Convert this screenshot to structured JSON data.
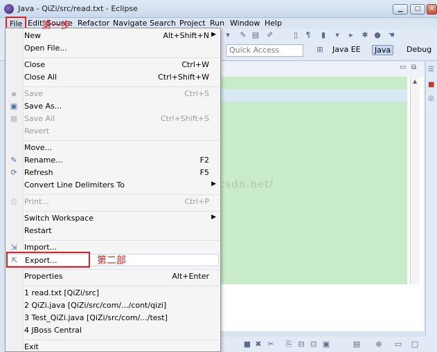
{
  "window": {
    "title": "Java - QiZi/src/read.txt - Eclipse",
    "btn_min": "▁",
    "btn_max": "□",
    "btn_close": "✕"
  },
  "menubar": [
    "File",
    "Edit",
    "Source",
    "Refactor",
    "Navigate",
    "Search",
    "Project",
    "Run",
    "Window",
    "Help"
  ],
  "toolbar": {
    "quick_access_placeholder": "Quick Access",
    "perspective_java_ee": "Java EE",
    "perspective_java": "Java",
    "perspective_debug": "Debug"
  },
  "annotations": {
    "step1": "第一步",
    "step2": "第二部"
  },
  "watermark": "http://blog.csdn.net/",
  "file_menu": {
    "new": {
      "label": "New",
      "accel": "Alt+Shift+N"
    },
    "open_file": {
      "label": "Open File..."
    },
    "close": {
      "label": "Close",
      "accel": "Ctrl+W"
    },
    "close_all": {
      "label": "Close All",
      "accel": "Ctrl+Shift+W"
    },
    "save": {
      "label": "Save",
      "accel": "Ctrl+S"
    },
    "save_as": {
      "label": "Save As..."
    },
    "save_all": {
      "label": "Save All",
      "accel": "Ctrl+Shift+S"
    },
    "revert": {
      "label": "Revert"
    },
    "move": {
      "label": "Move..."
    },
    "rename": {
      "label": "Rename...",
      "accel": "F2"
    },
    "refresh": {
      "label": "Refresh",
      "accel": "F5"
    },
    "convert": {
      "label": "Convert Line Delimiters To"
    },
    "print": {
      "label": "Print...",
      "accel": "Ctrl+P"
    },
    "switch_workspace": {
      "label": "Switch Workspace"
    },
    "restart": {
      "label": "Restart"
    },
    "import": {
      "label": "Import..."
    },
    "export": {
      "label": "Export..."
    },
    "properties": {
      "label": "Properties",
      "accel": "Alt+Enter"
    },
    "recent": [
      {
        "label": "1 read.txt  [QiZi/src]"
      },
      {
        "label": "2 QiZi.java  [QiZi/src/com/.../cont/qizi]"
      },
      {
        "label": "3 Test_QiZi.java  [QiZi/src/com/.../test]"
      },
      {
        "label": "4 JBoss Central"
      }
    ],
    "exit": {
      "label": "Exit"
    }
  }
}
